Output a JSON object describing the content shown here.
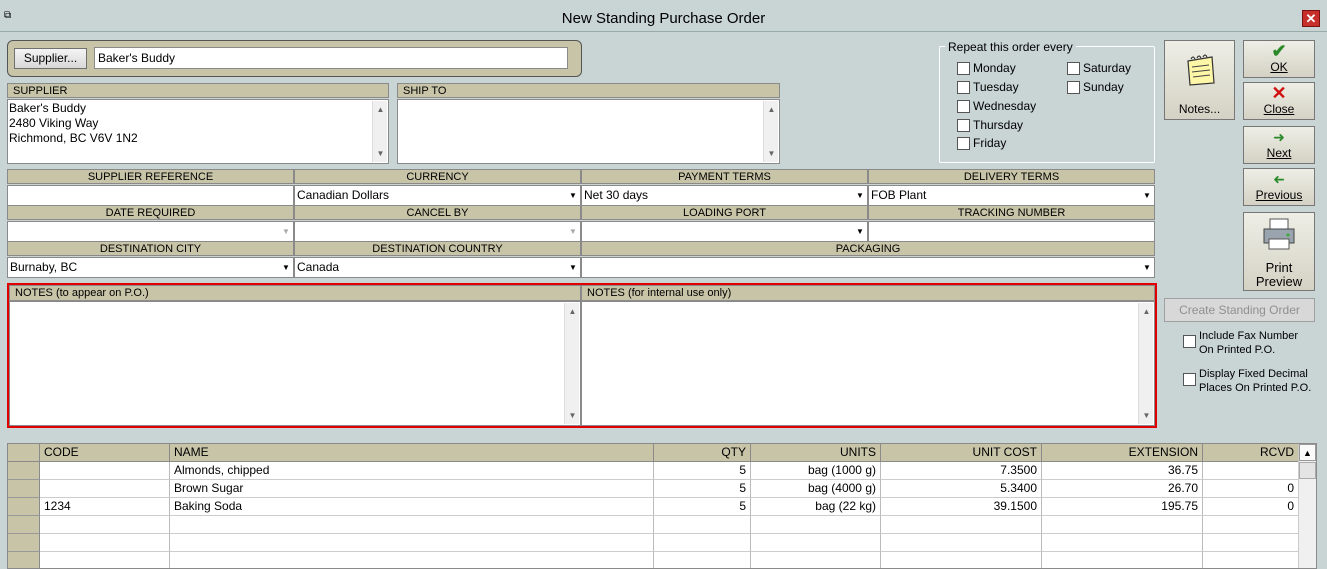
{
  "window": {
    "title": "New Standing Purchase Order",
    "close": "✕"
  },
  "supplier_bar": {
    "button": "Supplier...",
    "value": "Baker's Buddy"
  },
  "supplier_box": {
    "label": "SUPPLIER",
    "lines": [
      "Baker's Buddy",
      "2480 Viking Way",
      "Richmond, BC  V6V 1N2"
    ]
  },
  "ship_to": {
    "label": "SHIP TO"
  },
  "repeat": {
    "legend": "Repeat this order every",
    "days": [
      "Monday",
      "Tuesday",
      "Wednesday",
      "Thursday",
      "Friday",
      "Saturday",
      "Sunday"
    ]
  },
  "notes_button": "Notes...",
  "side_buttons": {
    "ok": "OK",
    "close": "Close",
    "next": "Next",
    "previous": "Previous",
    "print": "Print",
    "preview": "Preview"
  },
  "fields": {
    "supplier_reference": {
      "label": "SUPPLIER REFERENCE",
      "value": ""
    },
    "currency": {
      "label": "CURRENCY",
      "value": "Canadian Dollars"
    },
    "payment_terms": {
      "label": "PAYMENT TERMS",
      "value": "Net 30 days"
    },
    "delivery_terms": {
      "label": "DELIVERY TERMS",
      "value": "FOB Plant"
    },
    "date_required": {
      "label": "DATE REQUIRED",
      "value": ""
    },
    "cancel_by": {
      "label": "CANCEL BY",
      "value": ""
    },
    "loading_port": {
      "label": "LOADING PORT",
      "value": ""
    },
    "tracking_number": {
      "label": "TRACKING NUMBER",
      "value": ""
    },
    "destination_city": {
      "label": "DESTINATION CITY",
      "value": "Burnaby, BC"
    },
    "destination_country": {
      "label": "DESTINATION COUNTRY",
      "value": "Canada"
    },
    "packaging": {
      "label": "PACKAGING",
      "value": ""
    }
  },
  "notes": {
    "po_label": "NOTES (to appear on P.O.)",
    "internal_label": "NOTES (for internal use only)"
  },
  "create_button": "Create Standing Order",
  "options": {
    "fax_line1": "Include Fax Number",
    "fax_line2": "On Printed P.O.",
    "decimal_line1": "Display Fixed Decimal",
    "decimal_line2": "Places On Printed P.O."
  },
  "grid": {
    "headers": [
      "CODE",
      "NAME",
      "QTY",
      "UNITS",
      "UNIT COST",
      "EXTENSION",
      "RCVD"
    ],
    "rows": [
      [
        "",
        "Almonds, chipped",
        "5",
        "bag (1000 g)",
        "7.3500",
        "36.75",
        ""
      ],
      [
        "",
        "Brown Sugar",
        "5",
        "bag (4000 g)",
        "5.3400",
        "26.70",
        "0"
      ],
      [
        "1234",
        "Baking Soda",
        "5",
        "bag (22 kg)",
        "39.1500",
        "195.75",
        "0"
      ],
      [
        "",
        "",
        "",
        "",
        "",
        "",
        ""
      ],
      [
        "",
        "",
        "",
        "",
        "",
        "",
        ""
      ],
      [
        "",
        "",
        "",
        "",
        "",
        "",
        ""
      ]
    ]
  },
  "colors": {
    "accent_red": "#e00000",
    "ok_green": "#2a8a2a",
    "close_red": "#d01010"
  }
}
